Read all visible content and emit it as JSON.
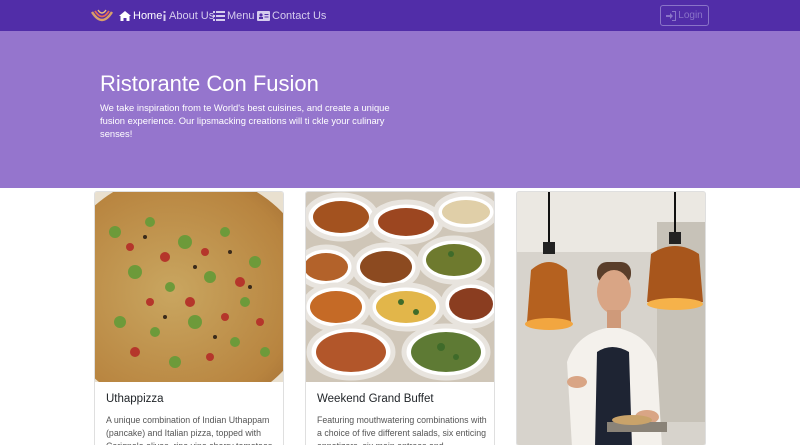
{
  "navbar": {
    "brand_icon": "restaurant-logo-icon",
    "items": [
      {
        "label": "Home",
        "icon": "home-icon",
        "active": true
      },
      {
        "label": "About Us",
        "icon": "info-icon",
        "active": false
      },
      {
        "label": "Menu",
        "icon": "list-icon",
        "active": false
      },
      {
        "label": "Contact Us",
        "icon": "address-card-icon",
        "active": false
      }
    ],
    "login_label": "Login",
    "login_icon": "sign-in-icon"
  },
  "jumbotron": {
    "title": "Ristorante Con Fusion",
    "text": "We take inspiration from te World's best cuisines, and create a unique fusion experience. Our lipsmacking creations will ti ckle your culinary senses!"
  },
  "cards": [
    {
      "title": "Uthappizza",
      "text": "A unique combination of Indian Uthappam (pancake) and Italian pizza, topped with Cerignola olives, ripe vine cherry tomatoes",
      "image": "pizza-photo"
    },
    {
      "title": "Weekend Grand Buffet",
      "text": "Featuring mouthwatering combinations with a choice of five different salads, six enticing appetizers, six main entrees and",
      "image": "buffet-photo"
    },
    {
      "title": "",
      "text": "",
      "image": "chef-photo"
    }
  ],
  "colors": {
    "navbar": "#512da8",
    "jumbotron": "#9575cd",
    "nav_text": "#d6cdee",
    "login_border": "#8a74c8"
  }
}
